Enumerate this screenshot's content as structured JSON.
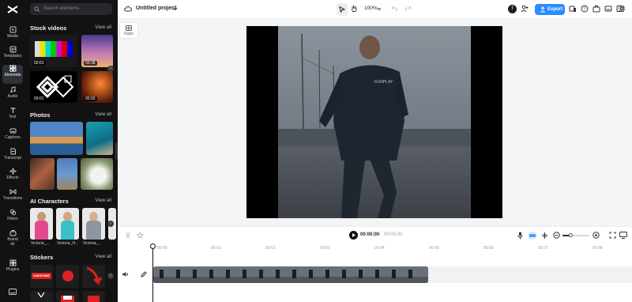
{
  "app": {
    "project_title": "Untitled project",
    "zoom": "100%",
    "export_label": "Export",
    "avatar_initial": "f"
  },
  "rail": [
    {
      "label": "Media",
      "icon": "media-icon"
    },
    {
      "label": "Templates",
      "icon": "templates-icon"
    },
    {
      "label": "Elements",
      "icon": "elements-icon",
      "active": true
    },
    {
      "label": "Audio",
      "icon": "audio-icon"
    },
    {
      "label": "Text",
      "icon": "text-icon"
    },
    {
      "label": "Captions",
      "icon": "captions-icon"
    },
    {
      "label": "Transcript",
      "icon": "transcript-icon"
    },
    {
      "label": "Effects",
      "icon": "effects-icon"
    },
    {
      "label": "Transitions",
      "icon": "transitions-icon"
    },
    {
      "label": "Filters",
      "icon": "filters-icon"
    },
    {
      "label": "Brand kit",
      "icon": "brand-kit-icon"
    },
    {
      "label": "Plugins",
      "icon": "plugins-icon"
    }
  ],
  "panel": {
    "search_placeholder": "Search elements",
    "view_all": "View all",
    "stock_videos": {
      "title": "Stock videos",
      "durations": [
        "00:01",
        "00:38",
        "00:01",
        "00:02"
      ]
    },
    "photos": {
      "title": "Photos"
    },
    "ai_characters": {
      "title": "AI Characters",
      "names": [
        "Victoria_...",
        "Victoria_H...",
        "Victoria_..."
      ]
    },
    "stickers": {
      "title": "Stickers",
      "subscribe_text": "SUBSCRIBE"
    }
  },
  "canvas": {
    "ratio_label": "Ratio",
    "shirt_text": "RUNPLAY"
  },
  "playback": {
    "current": "00:00:00",
    "separator": "/",
    "total": "00:05:00"
  },
  "timeline": {
    "ticks": [
      "00:00",
      "00:01",
      "00:02",
      "00:03",
      "00:04",
      "00:05",
      "00:06",
      "00:07",
      "00:08"
    ]
  },
  "colors": {
    "accent": "#2c8cff",
    "panel_bg": "#121212",
    "stage_bg": "#f3f4f6"
  }
}
